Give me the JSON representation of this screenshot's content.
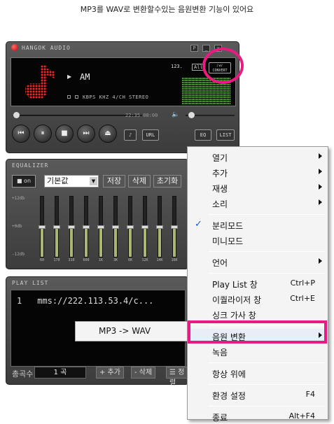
{
  "caption": "MP3를 WAV로 변환할수있는 음원변환 기능이 있어요",
  "colors": {
    "highlight": "#ea1a82",
    "spectrum": "#7cc85a",
    "note": "#ff2020"
  },
  "player": {
    "title": "HANGOK AUDIO",
    "title_buttons": [
      "P",
      "_",
      "×"
    ],
    "track": "AM",
    "meta": "KBPS   KHZ 4/CH STEREO",
    "num_label": "123.",
    "all_label": "All",
    "convert_top": "♪⇄♪",
    "convert_label": "CONVERT",
    "time": "22:35 00:00",
    "seek_progress": 0,
    "eq_label": "EQ",
    "list_label": "LIST",
    "url_label": "URL",
    "icons": [
      "prev-icon",
      "pause-icon",
      "stop-icon",
      "next-icon",
      "eject-icon",
      "folder-icon",
      "volume-icon"
    ]
  },
  "equalizer": {
    "title": "EQUALIZER",
    "on_label": "■ on",
    "preset": "기본값",
    "save": "저장",
    "delete": "삭제",
    "reset": "초기화",
    "db_top": "+12db",
    "db_mid": "+0db",
    "db_bottom": "-12db",
    "bands": [
      {
        "freq": "60",
        "level": 0
      },
      {
        "freq": "170",
        "level": 0
      },
      {
        "freq": "310",
        "level": 0
      },
      {
        "freq": "600",
        "level": 0
      },
      {
        "freq": "1K",
        "level": 0
      },
      {
        "freq": "3K",
        "level": 0
      },
      {
        "freq": "6K",
        "level": 0
      },
      {
        "freq": "12K",
        "level": 0
      },
      {
        "freq": "14K",
        "level": 0
      },
      {
        "freq": "16K",
        "level": 0
      }
    ]
  },
  "playlist": {
    "title": "PLAY LIST",
    "items": [
      {
        "num": "1",
        "text": "mms://222.113.53.4/c..."
      }
    ],
    "total_label": "총곡수",
    "count": "1 곡",
    "add": "+ 추가",
    "remove": "- 삭제",
    "sort": "☰ 정렬"
  },
  "submenu": {
    "item": "MP3 -> WAV"
  },
  "context_menu": {
    "items": [
      {
        "label": "열기",
        "arrow": true
      },
      {
        "label": "추가",
        "arrow": true
      },
      {
        "label": "재생",
        "arrow": true
      },
      {
        "label": "소리",
        "arrow": true
      },
      {
        "sep": true
      },
      {
        "label": "분리모드",
        "checked": true
      },
      {
        "label": "미니모드"
      },
      {
        "sep": true
      },
      {
        "label": "언어",
        "arrow": true
      },
      {
        "sep": true
      },
      {
        "label": "Play List 창",
        "shortcut": "Ctrl+P"
      },
      {
        "label": "이퀄라이저 창",
        "shortcut": "Ctrl+E"
      },
      {
        "label": "싱크 가사 창"
      },
      {
        "sep": true
      },
      {
        "label": "음원 변환",
        "arrow": true,
        "active": true
      },
      {
        "label": "녹음"
      },
      {
        "sep": true
      },
      {
        "label": "항상 위에"
      },
      {
        "sep": true
      },
      {
        "label": "환경 설정",
        "shortcut": "F4"
      },
      {
        "sep": true
      },
      {
        "label": "종료",
        "shortcut": "Alt+F4"
      }
    ]
  }
}
